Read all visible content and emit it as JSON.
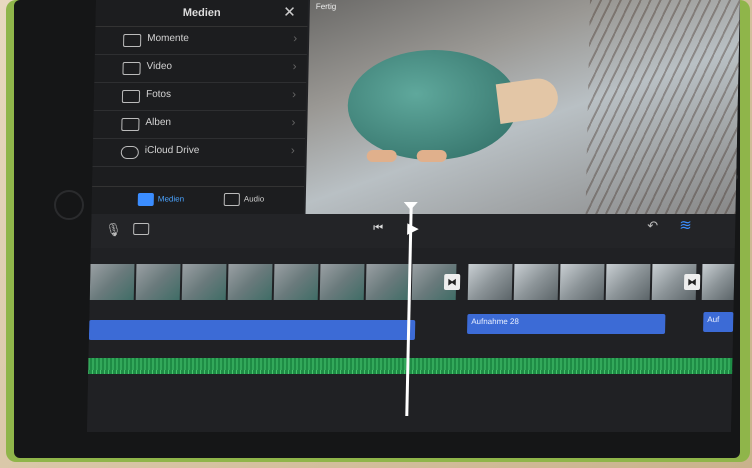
{
  "media_panel": {
    "title": "Medien",
    "items": [
      {
        "label": "Momente",
        "icon": "moments-icon"
      },
      {
        "label": "Video",
        "icon": "film-icon"
      },
      {
        "label": "Fotos",
        "icon": "photo-icon"
      },
      {
        "label": "Alben",
        "icon": "album-icon"
      },
      {
        "label": "iCloud Drive",
        "icon": "cloud-icon"
      }
    ],
    "tabs": [
      {
        "label": "Medien",
        "active": true
      },
      {
        "label": "Audio",
        "active": false
      }
    ]
  },
  "viewer": {
    "label": "Fertig"
  },
  "toolbar": {
    "accent_color": "#3b8dff"
  },
  "timeline": {
    "audio_clips": [
      {
        "label": ""
      },
      {
        "label": "Aufnahme 28"
      },
      {
        "label": "Auf"
      }
    ],
    "audio_color": "#3c6bd6",
    "background_music_color": "#1e8c45"
  }
}
